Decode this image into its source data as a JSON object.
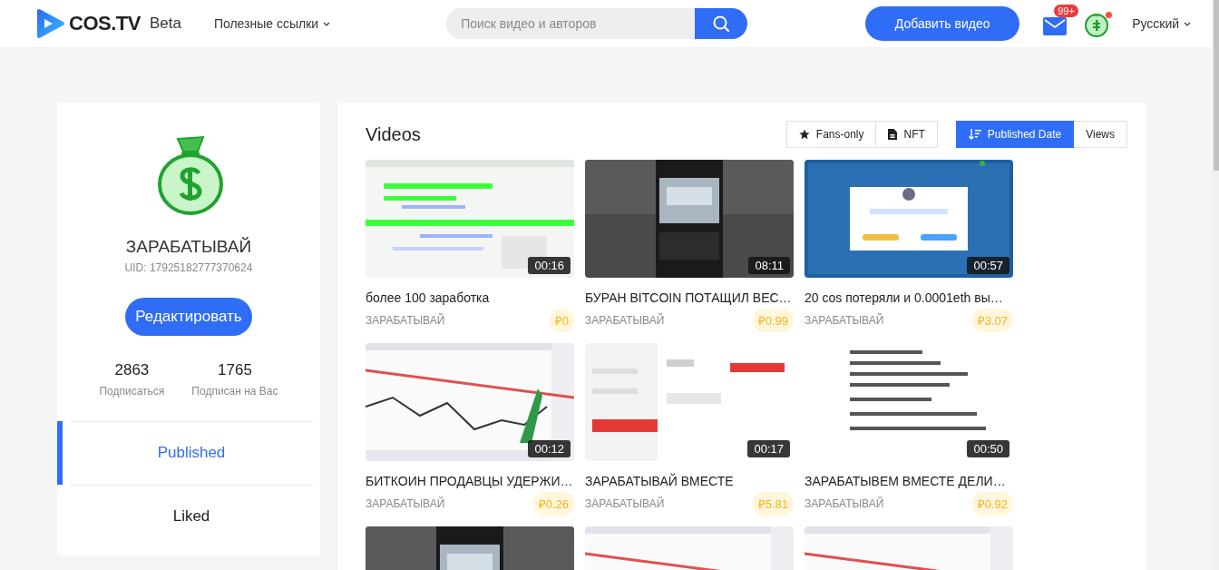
{
  "header": {
    "logo": "COS.TV",
    "beta": "Beta",
    "links_menu": "Полезные ссылки",
    "search": {
      "placeholder": "Поиск видео и авторов"
    },
    "add_button": "Добавить видео",
    "notifications_badge": "99+",
    "language": "Русский"
  },
  "profile": {
    "name": "ЗАРАБАТЫВАЙ",
    "uid": "UID: 17925182777370624",
    "edit_button": "Редактировать",
    "stats": [
      {
        "value": "2863",
        "label": "Подписаться"
      },
      {
        "value": "1765",
        "label": "Подписан на Вас"
      }
    ],
    "tabs": [
      {
        "label": "Published",
        "selected": true
      },
      {
        "label": "Liked",
        "selected": false
      }
    ]
  },
  "videos": {
    "title": "Videos",
    "filters": [
      {
        "label": "Fans-only",
        "kind": "star"
      },
      {
        "label": "NFT",
        "kind": "file"
      }
    ],
    "sort": [
      {
        "label": "Published Date",
        "selected": true
      },
      {
        "label": "Views",
        "selected": false
      }
    ],
    "items": [
      {
        "title": "более 100 заработка",
        "author": "ЗАРАБАТЫВАЙ",
        "price": "₽0",
        "duration": "00:16"
      },
      {
        "title": "БУРАН BITCOIN ПОТАЩИЛ ВЕС…",
        "author": "ЗАРАБАТЫВАЙ",
        "price": "₽0.99",
        "duration": "08:11"
      },
      {
        "title": "20 cos потеряли и 0.0001eth вы…",
        "author": "ЗАРАБАТЫВАЙ",
        "price": "₽3.07",
        "duration": "00:57"
      },
      {
        "title": "БИТКОИН ПРОДАВЦЫ УДЕРЖИ…",
        "author": "ЗАРАБАТЫВАЙ",
        "price": "₽0.26",
        "duration": "00:12"
      },
      {
        "title": "ЗАРАБАТЫВАЙ ВМЕСТЕ",
        "author": "ЗАРАБАТЫВАЙ",
        "price": "₽5.81",
        "duration": "00:17"
      },
      {
        "title": "ЗАРАБАТЫВЕМ ВМЕСТЕ ДЕЛИ…",
        "author": "ЗАРАБАТЫВАЙ",
        "price": "₽0.92",
        "duration": "00:50"
      },
      {
        "kind": "picture"
      },
      {
        "kind": "picture"
      },
      {
        "kind": "picture"
      }
    ]
  }
}
